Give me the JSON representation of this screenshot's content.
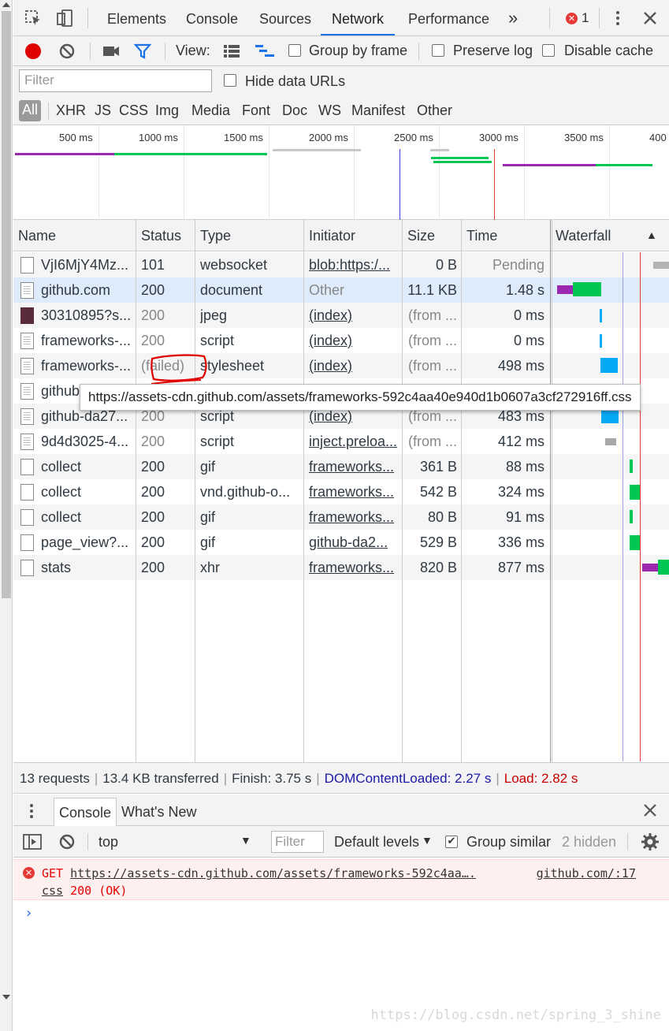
{
  "tabs": {
    "items": [
      "Elements",
      "Console",
      "Sources",
      "Network",
      "Performance"
    ],
    "more": "»",
    "error_count": "1"
  },
  "toolbar": {
    "view_label": "View:",
    "group_by_frame": "Group by frame",
    "preserve_log": "Preserve log",
    "disable_cache": "Disable cache"
  },
  "filter": {
    "placeholder": "Filter",
    "hide_data_urls": "Hide data URLs"
  },
  "types": [
    "All",
    "XHR",
    "JS",
    "CSS",
    "Img",
    "Media",
    "Font",
    "Doc",
    "WS",
    "Manifest",
    "Other"
  ],
  "overview": {
    "ticks": [
      "500 ms",
      "1000 ms",
      "1500 ms",
      "2000 ms",
      "2500 ms",
      "3000 ms",
      "3500 ms",
      "400"
    ]
  },
  "table": {
    "headers": [
      "Name",
      "Status",
      "Type",
      "Initiator",
      "Size",
      "Time",
      "Waterfall"
    ],
    "sort_indicator": "▲",
    "rows": [
      {
        "name": "VjI6MjY4Mz...",
        "status": "101",
        "type": "websocket",
        "initiator": "blob:https:/...",
        "size": "0 B",
        "time": "Pending"
      },
      {
        "name": "github.com",
        "status": "200",
        "type": "document",
        "initiator": "Other",
        "size": "11.1 KB",
        "time": "1.48 s"
      },
      {
        "name": "30310895?s...",
        "status": "200",
        "type": "jpeg",
        "initiator": "(index)",
        "size": "(from ...",
        "time": "0 ms"
      },
      {
        "name": "frameworks-...",
        "status": "200",
        "type": "script",
        "initiator": "(index)",
        "size": "(from ...",
        "time": "0 ms"
      },
      {
        "name": "frameworks-...",
        "status": "(failed)",
        "type": "stylesheet",
        "initiator": "(index)",
        "size": "(from ...",
        "time": "498 ms"
      },
      {
        "name": "github",
        "status": "",
        "type": "",
        "initiator": "",
        "size": "",
        "time": ""
      },
      {
        "name": "github-da27...",
        "status": "200",
        "type": "script",
        "initiator": "(index)",
        "size": "(from ...",
        "time": "483 ms"
      },
      {
        "name": "9d4d3025-4...",
        "status": "200",
        "type": "script",
        "initiator": "inject.preloa...",
        "size": "(from ...",
        "time": "412 ms"
      },
      {
        "name": "collect",
        "status": "200",
        "type": "gif",
        "initiator": "frameworks...",
        "size": "361 B",
        "time": "88 ms"
      },
      {
        "name": "collect",
        "status": "200",
        "type": "vnd.github-o...",
        "initiator": "frameworks...",
        "size": "542 B",
        "time": "324 ms"
      },
      {
        "name": "collect",
        "status": "200",
        "type": "gif",
        "initiator": "frameworks...",
        "size": "80 B",
        "time": "91 ms"
      },
      {
        "name": "page_view?...",
        "status": "200",
        "type": "gif",
        "initiator": "github-da2...",
        "size": "529 B",
        "time": "336 ms"
      },
      {
        "name": "stats",
        "status": "200",
        "type": "xhr",
        "initiator": "frameworks...",
        "size": "820 B",
        "time": "877 ms"
      }
    ],
    "tooltip": "https://assets-cdn.github.com/assets/frameworks-592c4aa40e940d1b0607a3cf272916ff.css"
  },
  "status": {
    "requests": "13 requests",
    "transferred": "13.4 KB transferred",
    "finish": "Finish: 3.75 s",
    "dcl": "DOMContentLoaded: 2.27 s",
    "load": "Load: 2.82 s"
  },
  "drawer": {
    "tabs": [
      "Console",
      "What's New"
    ],
    "context": "top",
    "filter_placeholder": "Filter",
    "levels": "Default levels",
    "group_similar": "Group similar",
    "hidden": "2 hidden"
  },
  "console": {
    "method": "GET",
    "url": "https://assets-cdn.github.com/assets/frameworks-592c4aa….",
    "url_tail": "css",
    "status": "200 (OK)",
    "source": "github.com/:17",
    "prompt": "›"
  },
  "colors": {
    "accent": "#1a73e8",
    "record": "#e00000",
    "waiting": "#9c27b0",
    "receiving": "#00c853",
    "script": "#03a9f4",
    "dcl_line": "#3d3df5",
    "load_line": "#e53935"
  },
  "watermark": "https://blog.csdn.net/spring_3_shine"
}
